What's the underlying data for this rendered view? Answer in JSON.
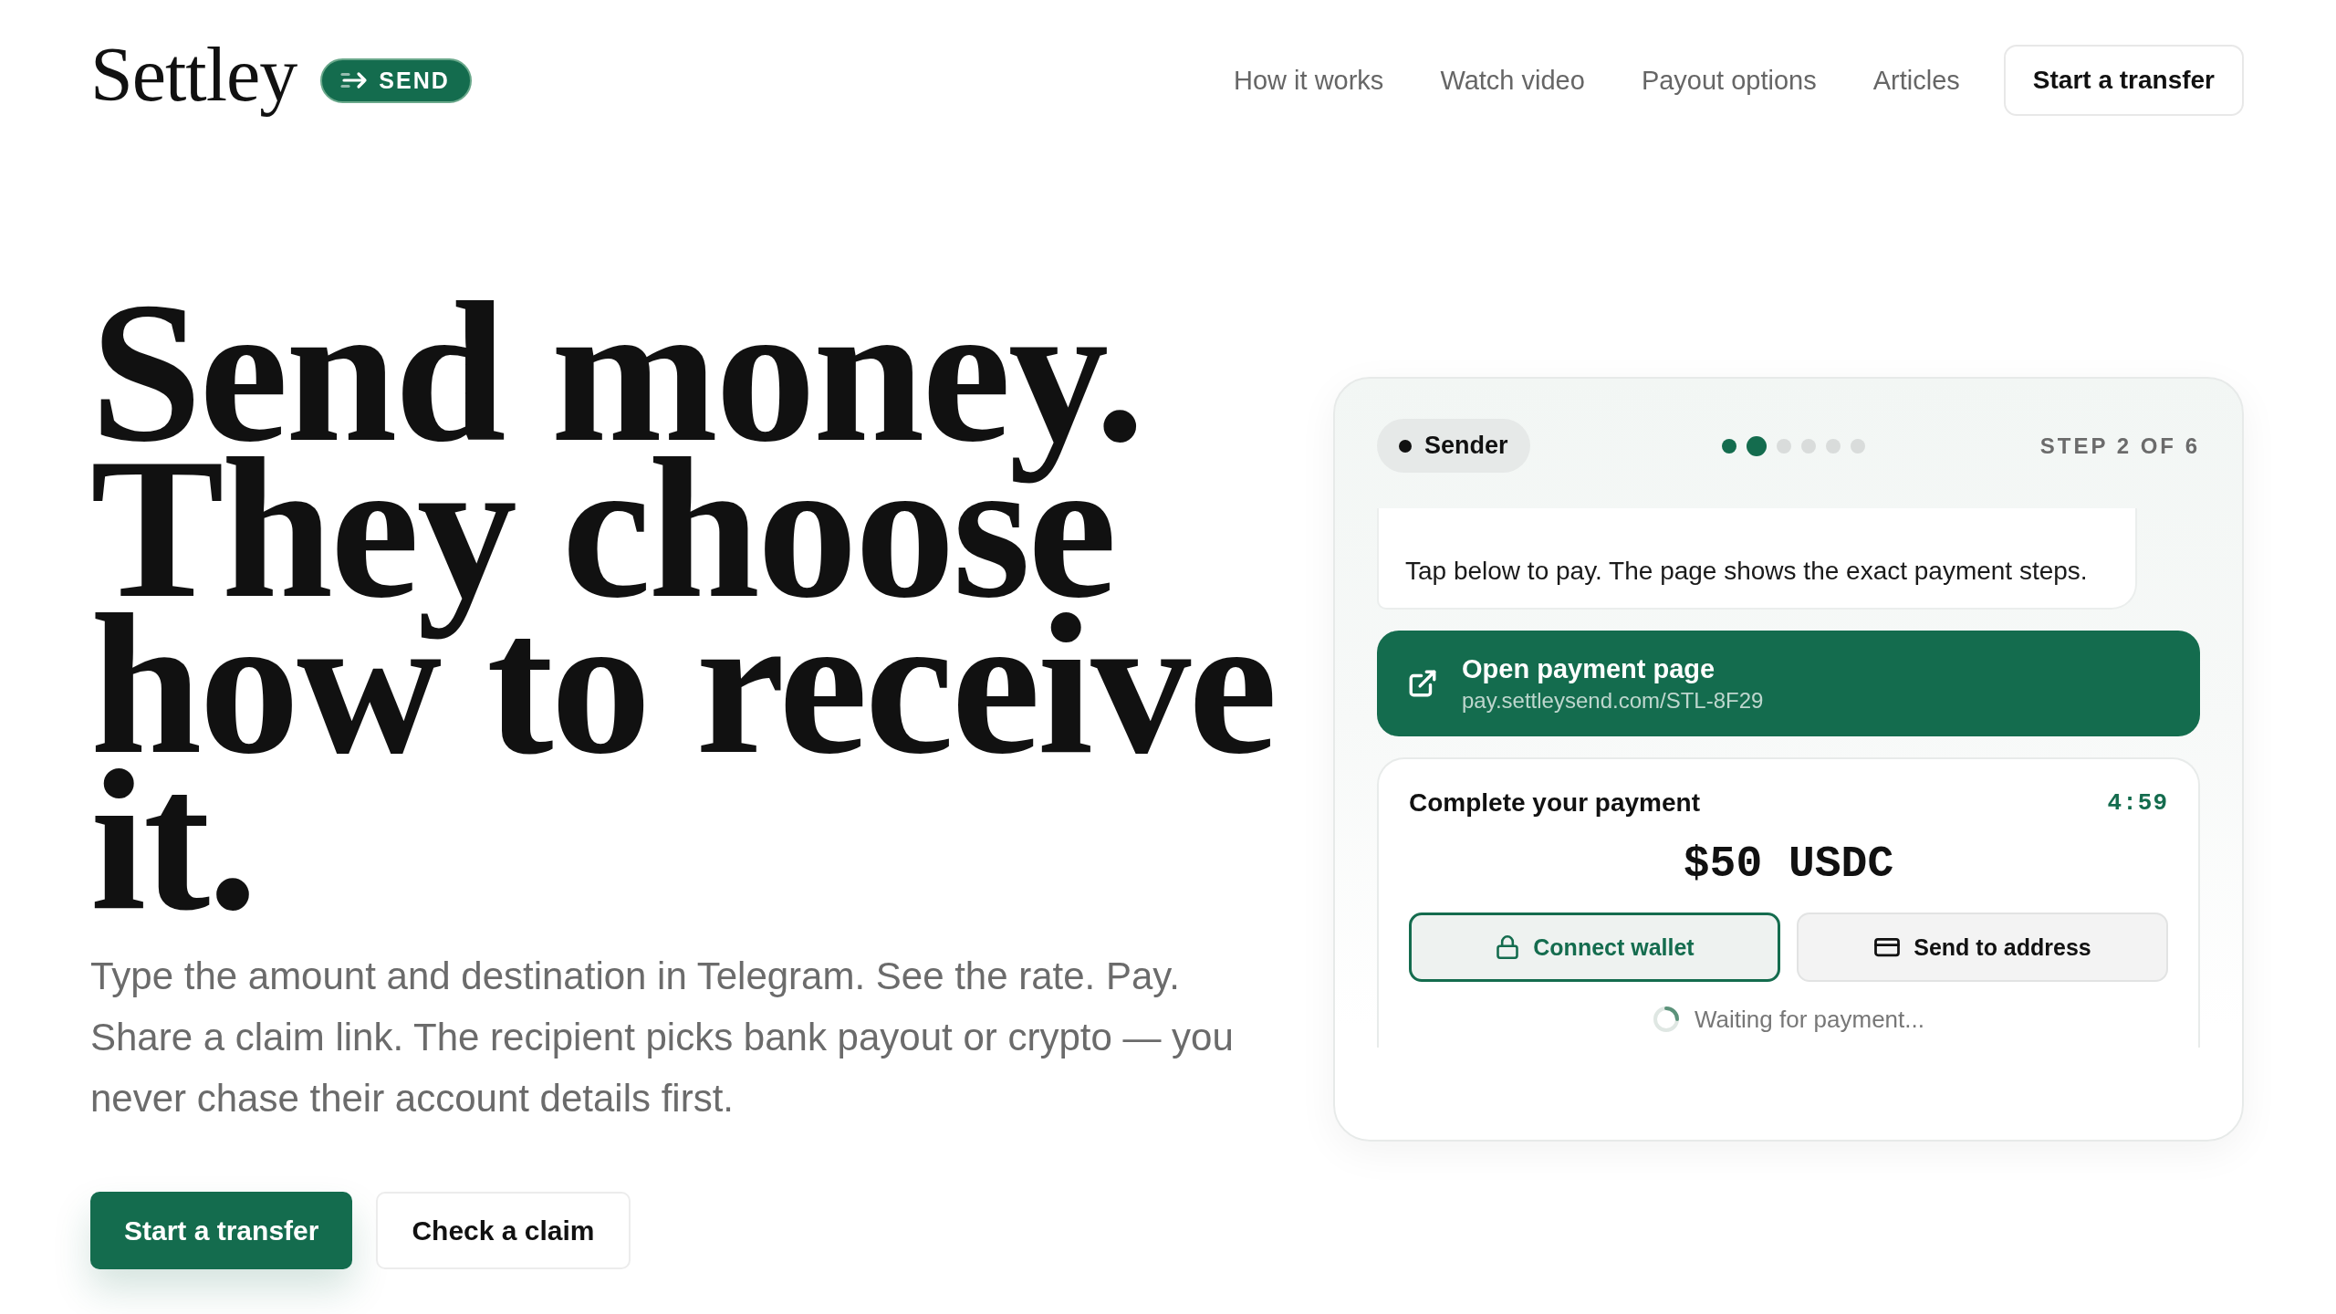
{
  "header": {
    "logo": {
      "wordmark": "Settley",
      "badge": "SEND"
    },
    "nav": [
      {
        "label": "How it works"
      },
      {
        "label": "Watch video"
      },
      {
        "label": "Payout options"
      },
      {
        "label": "Articles"
      }
    ],
    "cta": "Start a transfer"
  },
  "hero": {
    "headline": "Send money. They choose how to receive it.",
    "lead": "Type the amount and destination in Telegram. See the rate. Pay. Share a claim link. The recipient picks bank payout or crypto — you never chase their account details first.",
    "buttons": [
      {
        "label": "Start a transfer",
        "kind": "primary"
      },
      {
        "label": "Check a claim",
        "kind": "secondary"
      }
    ]
  },
  "preview": {
    "role": "Sender",
    "steps": [
      {
        "kind": "done"
      },
      {
        "kind": "current"
      },
      {
        "kind": "upcoming"
      },
      {
        "kind": "upcoming"
      },
      {
        "kind": "upcoming"
      },
      {
        "kind": "upcoming"
      }
    ],
    "step_label": "STEP 2 OF 6",
    "message": "Tap below to pay. The page shows the exact payment steps.",
    "open_link": {
      "title": "Open payment page",
      "url": "pay.settleysend.com/STL-8F29"
    },
    "payment": {
      "title": "Complete your payment",
      "timer": "4:59",
      "amount": "$50 USDC",
      "methods": [
        {
          "label": "Connect wallet",
          "kind": "wallet",
          "selected": true
        },
        {
          "label": "Send to address",
          "kind": "address",
          "selected": false
        }
      ],
      "status": "Waiting for payment..."
    }
  }
}
